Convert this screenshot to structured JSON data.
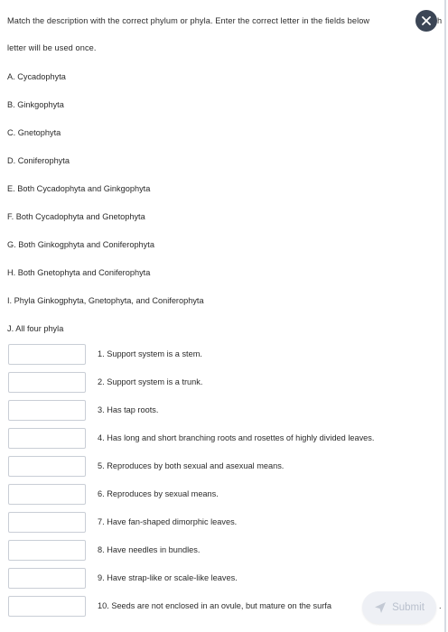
{
  "instructions": {
    "line1": "Match the description with the correct phylum or phyla. Enter the correct letter in the fields below",
    "line2": "letter will be used once.",
    "line1_tail": "h"
  },
  "options": [
    "A. Cycadophyta",
    "B. Ginkgophyta",
    "C. Gnetophyta",
    "D. Coniferophyta",
    "E. Both Cycadophyta and Ginkgophyta",
    "F. Both Cycadophyta and Gnetophyta",
    "G. Both Ginkogphyta and Coniferophyta",
    "H. Both Gnetophyta and Coniferophyta",
    "I. Phyla Ginkogphyta, Gnetophyta, and Coniferophyta",
    "J. All four phyla"
  ],
  "questions": [
    {
      "label": "1.  Support system is a stem.",
      "value": ""
    },
    {
      "label": "2.  Support system is a trunk.",
      "value": ""
    },
    {
      "label": "3.  Has tap roots.",
      "value": ""
    },
    {
      "label": "4.  Has long and short branching roots and rosettes of highly divided leaves.",
      "value": ""
    },
    {
      "label": "5.  Reproduces by both sexual and asexual means.",
      "value": ""
    },
    {
      "label": "6.  Reproduces by sexual means.",
      "value": ""
    },
    {
      "label": "7.  Have fan-shaped dimorphic leaves.",
      "value": ""
    },
    {
      "label": "8.  Have needles in bundles.",
      "value": ""
    },
    {
      "label": "9.  Have strap-like or scale-like leaves.",
      "value": ""
    },
    {
      "label": "10.  Seeds are not enclosed in an ovule, but mature on the surfa",
      "value": ""
    }
  ],
  "close_button": {
    "icon": "close-icon",
    "color": "#3b4555"
  },
  "submit_button": {
    "label": "Submit",
    "icon": "send-icon"
  },
  "tail_text": "."
}
